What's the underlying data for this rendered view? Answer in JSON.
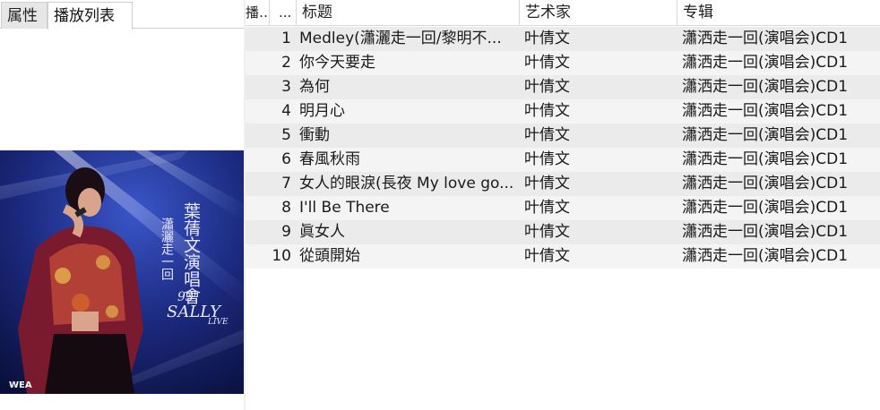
{
  "tabs": [
    {
      "label": "属性"
    },
    {
      "label": "播放列表"
    }
  ],
  "album_art": {
    "text_cn_1": "葉蒨文演唱會",
    "text_cn_2": "瀟灑走一回",
    "year": "93'",
    "name": "SALLY",
    "live": "LIVE",
    "logo": "WEA"
  },
  "playlist": {
    "columns": {
      "num": "播…",
      "dots": "...",
      "title": "标题",
      "artist": "艺术家",
      "album": "专辑"
    },
    "rows": [
      {
        "num": "1",
        "title": "Medley(瀟灑走一回/黎明不...",
        "artist": "叶倩文",
        "album": "瀟洒走一回(演唱会)CD1"
      },
      {
        "num": "2",
        "title": "你今天要走",
        "artist": "叶倩文",
        "album": "瀟洒走一回(演唱会)CD1"
      },
      {
        "num": "3",
        "title": "為何",
        "artist": "叶倩文",
        "album": "瀟洒走一回(演唱会)CD1"
      },
      {
        "num": "4",
        "title": "明月心",
        "artist": "叶倩文",
        "album": "瀟洒走一回(演唱会)CD1"
      },
      {
        "num": "5",
        "title": "衝動",
        "artist": "叶倩文",
        "album": "瀟洒走一回(演唱会)CD1"
      },
      {
        "num": "6",
        "title": "春風秋雨",
        "artist": "叶倩文",
        "album": "瀟洒走一回(演唱会)CD1"
      },
      {
        "num": "7",
        "title": "女人的眼淚(長夜 My love go...",
        "artist": "叶倩文",
        "album": "瀟洒走一回(演唱会)CD1"
      },
      {
        "num": "8",
        "title": "I'll Be There",
        "artist": "叶倩文",
        "album": "瀟洒走一回(演唱会)CD1"
      },
      {
        "num": "9",
        "title": "眞女人",
        "artist": "叶倩文",
        "album": "瀟洒走一回(演唱会)CD1"
      },
      {
        "num": "10",
        "title": "從頭開始",
        "artist": "叶倩文",
        "album": "瀟洒走一回(演唱会)CD1"
      }
    ]
  }
}
